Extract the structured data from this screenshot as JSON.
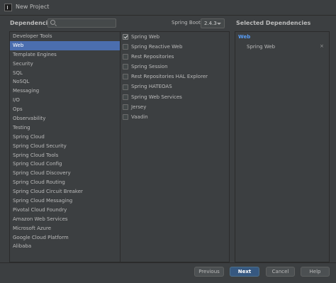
{
  "window": {
    "title": "New Project"
  },
  "header": {
    "dependencies_label": "Dependencies",
    "search_value": "",
    "spring_boot_label": "Spring Boot",
    "spring_boot_version": "2.4.3",
    "selected_title": "Selected Dependencies"
  },
  "categories": [
    {
      "label": "Developer Tools",
      "selected": false
    },
    {
      "label": "Web",
      "selected": true
    },
    {
      "label": "Template Engines",
      "selected": false
    },
    {
      "label": "Security",
      "selected": false
    },
    {
      "label": "SQL",
      "selected": false
    },
    {
      "label": "NoSQL",
      "selected": false
    },
    {
      "label": "Messaging",
      "selected": false
    },
    {
      "label": "I/O",
      "selected": false
    },
    {
      "label": "Ops",
      "selected": false
    },
    {
      "label": "Observability",
      "selected": false
    },
    {
      "label": "Testing",
      "selected": false
    },
    {
      "label": "Spring Cloud",
      "selected": false
    },
    {
      "label": "Spring Cloud Security",
      "selected": false
    },
    {
      "label": "Spring Cloud Tools",
      "selected": false
    },
    {
      "label": "Spring Cloud Config",
      "selected": false
    },
    {
      "label": "Spring Cloud Discovery",
      "selected": false
    },
    {
      "label": "Spring Cloud Routing",
      "selected": false
    },
    {
      "label": "Spring Cloud Circuit Breaker",
      "selected": false
    },
    {
      "label": "Spring Cloud Messaging",
      "selected": false
    },
    {
      "label": "Pivotal Cloud Foundry",
      "selected": false
    },
    {
      "label": "Amazon Web Services",
      "selected": false
    },
    {
      "label": "Microsoft Azure",
      "selected": false
    },
    {
      "label": "Google Cloud Platform",
      "selected": false
    },
    {
      "label": "Alibaba",
      "selected": false
    }
  ],
  "dependencies": [
    {
      "label": "Spring Web",
      "checked": true
    },
    {
      "label": "Spring Reactive Web",
      "checked": false
    },
    {
      "label": "Rest Repositories",
      "checked": false
    },
    {
      "label": "Spring Session",
      "checked": false
    },
    {
      "label": "Rest Repositories HAL Explorer",
      "checked": false
    },
    {
      "label": "Spring HATEOAS",
      "checked": false
    },
    {
      "label": "Spring Web Services",
      "checked": false
    },
    {
      "label": "Jersey",
      "checked": false
    },
    {
      "label": "Vaadin",
      "checked": false
    }
  ],
  "selected": {
    "group": "Web",
    "items": [
      {
        "label": "Spring Web",
        "remove": "×"
      }
    ]
  },
  "buttons": {
    "previous": "Previous",
    "next": "Next",
    "cancel": "Cancel",
    "help": "Help"
  },
  "colors": {
    "background": "#3c3f41",
    "selection": "#4b6eaf",
    "primary_button": "#365880",
    "group_text": "#589df6"
  },
  "icons": {
    "app": "intellij-idea-icon",
    "search": "search-icon",
    "dropdown": "chevron-down-icon"
  }
}
